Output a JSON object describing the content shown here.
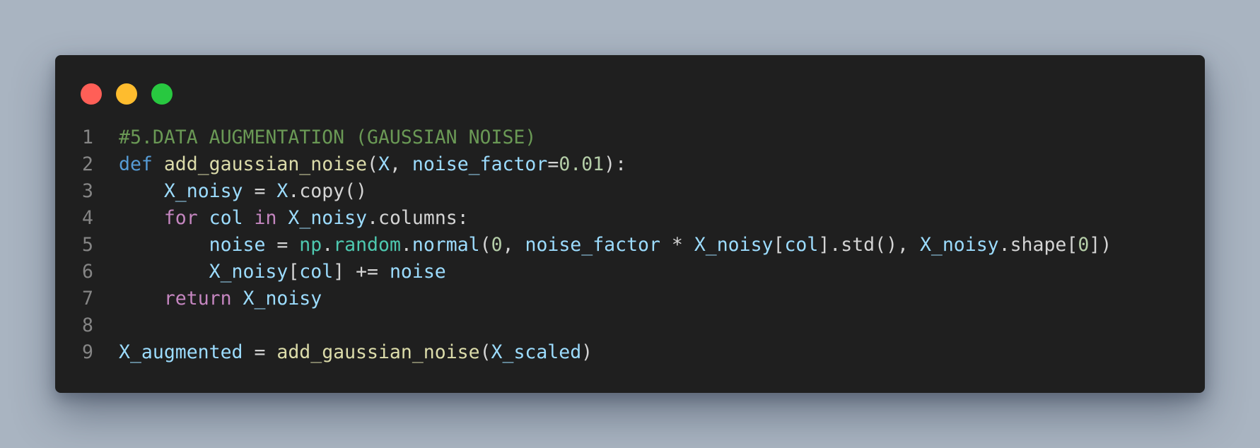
{
  "window": {
    "controls": {
      "close_color": "#ff5f57",
      "minimize_color": "#febc2e",
      "maximize_color": "#28c840"
    }
  },
  "code": {
    "language": "python",
    "lines": [
      {
        "number": "1",
        "tokens": [
          {
            "text": "#5.DATA AUGMENTATION (GAUSSIAN NOISE)",
            "type": "comment"
          }
        ]
      },
      {
        "number": "2",
        "tokens": [
          {
            "text": "def",
            "type": "kw"
          },
          {
            "text": " ",
            "type": "op"
          },
          {
            "text": "add_gaussian_noise",
            "type": "fn"
          },
          {
            "text": "(",
            "type": "op"
          },
          {
            "text": "X",
            "type": "var"
          },
          {
            "text": ", ",
            "type": "op"
          },
          {
            "text": "noise_factor",
            "type": "var"
          },
          {
            "text": "=",
            "type": "op"
          },
          {
            "text": "0.01",
            "type": "num"
          },
          {
            "text": "):",
            "type": "op"
          }
        ]
      },
      {
        "number": "3",
        "tokens": [
          {
            "text": "    ",
            "type": "op"
          },
          {
            "text": "X_noisy",
            "type": "var"
          },
          {
            "text": " = ",
            "type": "op"
          },
          {
            "text": "X",
            "type": "var"
          },
          {
            "text": ".copy()",
            "type": "op"
          }
        ]
      },
      {
        "number": "4",
        "tokens": [
          {
            "text": "    ",
            "type": "op"
          },
          {
            "text": "for",
            "type": "ctrl"
          },
          {
            "text": " ",
            "type": "op"
          },
          {
            "text": "col",
            "type": "var"
          },
          {
            "text": " ",
            "type": "op"
          },
          {
            "text": "in",
            "type": "ctrl"
          },
          {
            "text": " ",
            "type": "op"
          },
          {
            "text": "X_noisy",
            "type": "var"
          },
          {
            "text": ".columns:",
            "type": "op"
          }
        ]
      },
      {
        "number": "5",
        "tokens": [
          {
            "text": "        ",
            "type": "op"
          },
          {
            "text": "noise",
            "type": "var"
          },
          {
            "text": " = ",
            "type": "op"
          },
          {
            "text": "np",
            "type": "mod"
          },
          {
            "text": ".",
            "type": "op"
          },
          {
            "text": "random",
            "type": "mod"
          },
          {
            "text": ".",
            "type": "op"
          },
          {
            "text": "normal",
            "type": "var"
          },
          {
            "text": "(",
            "type": "op"
          },
          {
            "text": "0",
            "type": "num"
          },
          {
            "text": ", ",
            "type": "op"
          },
          {
            "text": "noise_factor",
            "type": "var"
          },
          {
            "text": " * ",
            "type": "op"
          },
          {
            "text": "X_noisy",
            "type": "var"
          },
          {
            "text": "[",
            "type": "op"
          },
          {
            "text": "col",
            "type": "var"
          },
          {
            "text": "].std(), ",
            "type": "op"
          },
          {
            "text": "X_noisy",
            "type": "var"
          },
          {
            "text": ".shape[",
            "type": "op"
          },
          {
            "text": "0",
            "type": "num"
          },
          {
            "text": "])",
            "type": "op"
          }
        ]
      },
      {
        "number": "6",
        "tokens": [
          {
            "text": "        ",
            "type": "op"
          },
          {
            "text": "X_noisy",
            "type": "var"
          },
          {
            "text": "[",
            "type": "op"
          },
          {
            "text": "col",
            "type": "var"
          },
          {
            "text": "] += ",
            "type": "op"
          },
          {
            "text": "noise",
            "type": "var"
          }
        ]
      },
      {
        "number": "7",
        "tokens": [
          {
            "text": "    ",
            "type": "op"
          },
          {
            "text": "return",
            "type": "ctrl"
          },
          {
            "text": " ",
            "type": "op"
          },
          {
            "text": "X_noisy",
            "type": "var"
          }
        ]
      },
      {
        "number": "8",
        "tokens": []
      },
      {
        "number": "9",
        "tokens": [
          {
            "text": "X_augmented",
            "type": "var"
          },
          {
            "text": " = ",
            "type": "op"
          },
          {
            "text": "add_gaussian_noise",
            "type": "fn"
          },
          {
            "text": "(",
            "type": "op"
          },
          {
            "text": "X_scaled",
            "type": "var"
          },
          {
            "text": ")",
            "type": "op"
          }
        ]
      }
    ]
  }
}
